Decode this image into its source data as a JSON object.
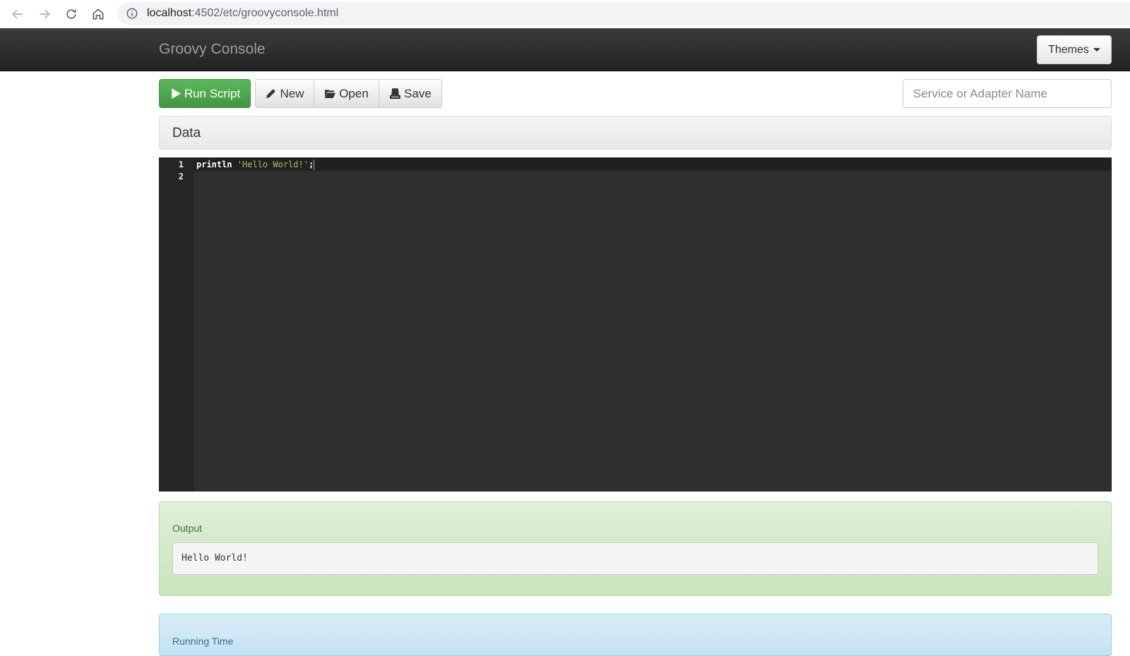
{
  "browser": {
    "url_host": "localhost",
    "url_path": ":4502/etc/groovyconsole.html"
  },
  "navbar": {
    "brand": "Groovy Console",
    "themes_label": "Themes"
  },
  "toolbar": {
    "run_label": "Run Script",
    "new_label": "New",
    "open_label": "Open",
    "save_label": "Save"
  },
  "search": {
    "placeholder": "Service or Adapter Name"
  },
  "data_panel": {
    "title": "Data"
  },
  "editor": {
    "line_numbers": [
      "1",
      "2"
    ],
    "line1_keyword": "println",
    "line1_string": "'Hello World!'",
    "line1_end": ";"
  },
  "output": {
    "label": "Output",
    "text": "Hello World!"
  },
  "running_time": {
    "label": "Running Time"
  },
  "colors": {
    "run_button": "#5cb85c",
    "navbar": "#222222",
    "editor_bg": "#2f2f2f",
    "string_token": "#a5c25c",
    "output_bg": "#dff0d8",
    "time_bg": "#d9edf7"
  }
}
